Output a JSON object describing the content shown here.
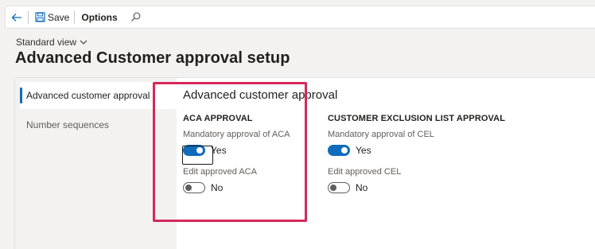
{
  "toolbar": {
    "back_icon": "back-arrow-icon",
    "save_icon": "floppy-disk-icon",
    "save_label": "Save",
    "options_label": "Options",
    "search_icon": "search-icon"
  },
  "view": {
    "label": "Standard view",
    "icon": "chevron-down-icon"
  },
  "page": {
    "title": "Advanced Customer approval setup"
  },
  "nav": {
    "items": [
      {
        "label": "Advanced customer approval",
        "active": true
      },
      {
        "label": "Number sequences",
        "active": false
      }
    ]
  },
  "section": {
    "title": "Advanced customer approval"
  },
  "groups": [
    {
      "heading": "ACA APPROVAL",
      "fields": [
        {
          "label": "Mandatory approval of ACA",
          "value": "Yes",
          "on": true
        },
        {
          "label": "Edit approved ACA",
          "value": "No",
          "on": false
        }
      ]
    },
    {
      "heading": "CUSTOMER EXCLUSION LIST APPROVAL",
      "fields": [
        {
          "label": "Mandatory approval of CEL",
          "value": "Yes",
          "on": true
        },
        {
          "label": "Edit approved CEL",
          "value": "No",
          "on": false
        }
      ]
    }
  ],
  "colors": {
    "accent": "#0f6cbd",
    "highlight": "#d6285a"
  }
}
